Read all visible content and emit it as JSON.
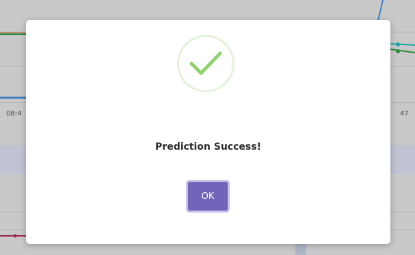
{
  "background": {
    "tick_left": "08:4",
    "tick_right": "47",
    "colors": {
      "overlay": "#c9c9c9",
      "teal_series": "#1aa5a8",
      "green_series": "#2a8b3a",
      "blue_series": "#3e7fc0",
      "magenta_series": "#9c2a4c"
    }
  },
  "dialog": {
    "icon": "checkmark-success-icon",
    "message": "Prediction Success!",
    "ok_label": "OK",
    "colors": {
      "check": "#8fd16b",
      "ring": "#e4f2d9",
      "button": "#7065b9",
      "button_border": "#c8c2ec"
    }
  }
}
